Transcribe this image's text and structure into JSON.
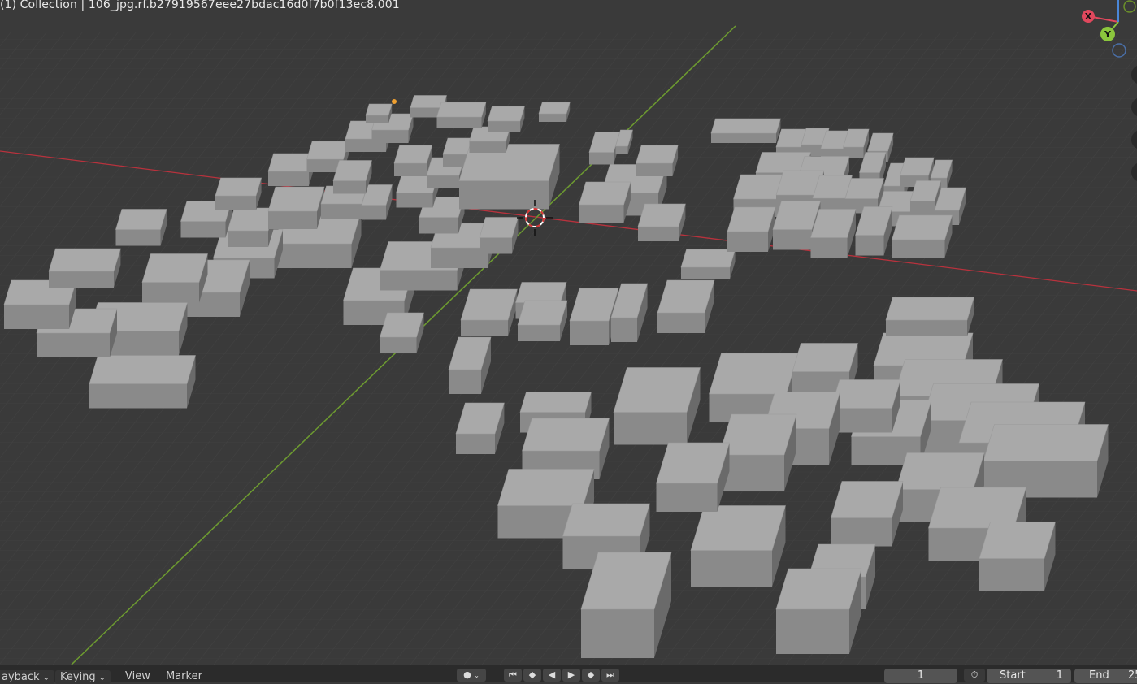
{
  "viewport": {
    "overlay_text": "(1) Collection | 106_jpg.rf.b27919567eee27bdac16d0f7b0f13ec8.001"
  },
  "gizmo": {
    "x_label": "X",
    "y_label": "Y",
    "x_color": "#e0485d",
    "y_color": "#8bc63d",
    "z_color": "#4a87d8"
  },
  "colors": {
    "grid_bg": "#3a3a3a",
    "x_axis": "#b8323d",
    "y_axis": "#6d9b30",
    "building_top": "#a9a9a9",
    "building_side": "#8a8a8a"
  },
  "timeline": {
    "playback_label": "ayback",
    "keying_label": "Keying",
    "view_label": "View",
    "marker_label": "Marker",
    "current_frame": "1",
    "start_label": "Start",
    "start_value": "1",
    "end_label": "End",
    "end_value": "25"
  }
}
